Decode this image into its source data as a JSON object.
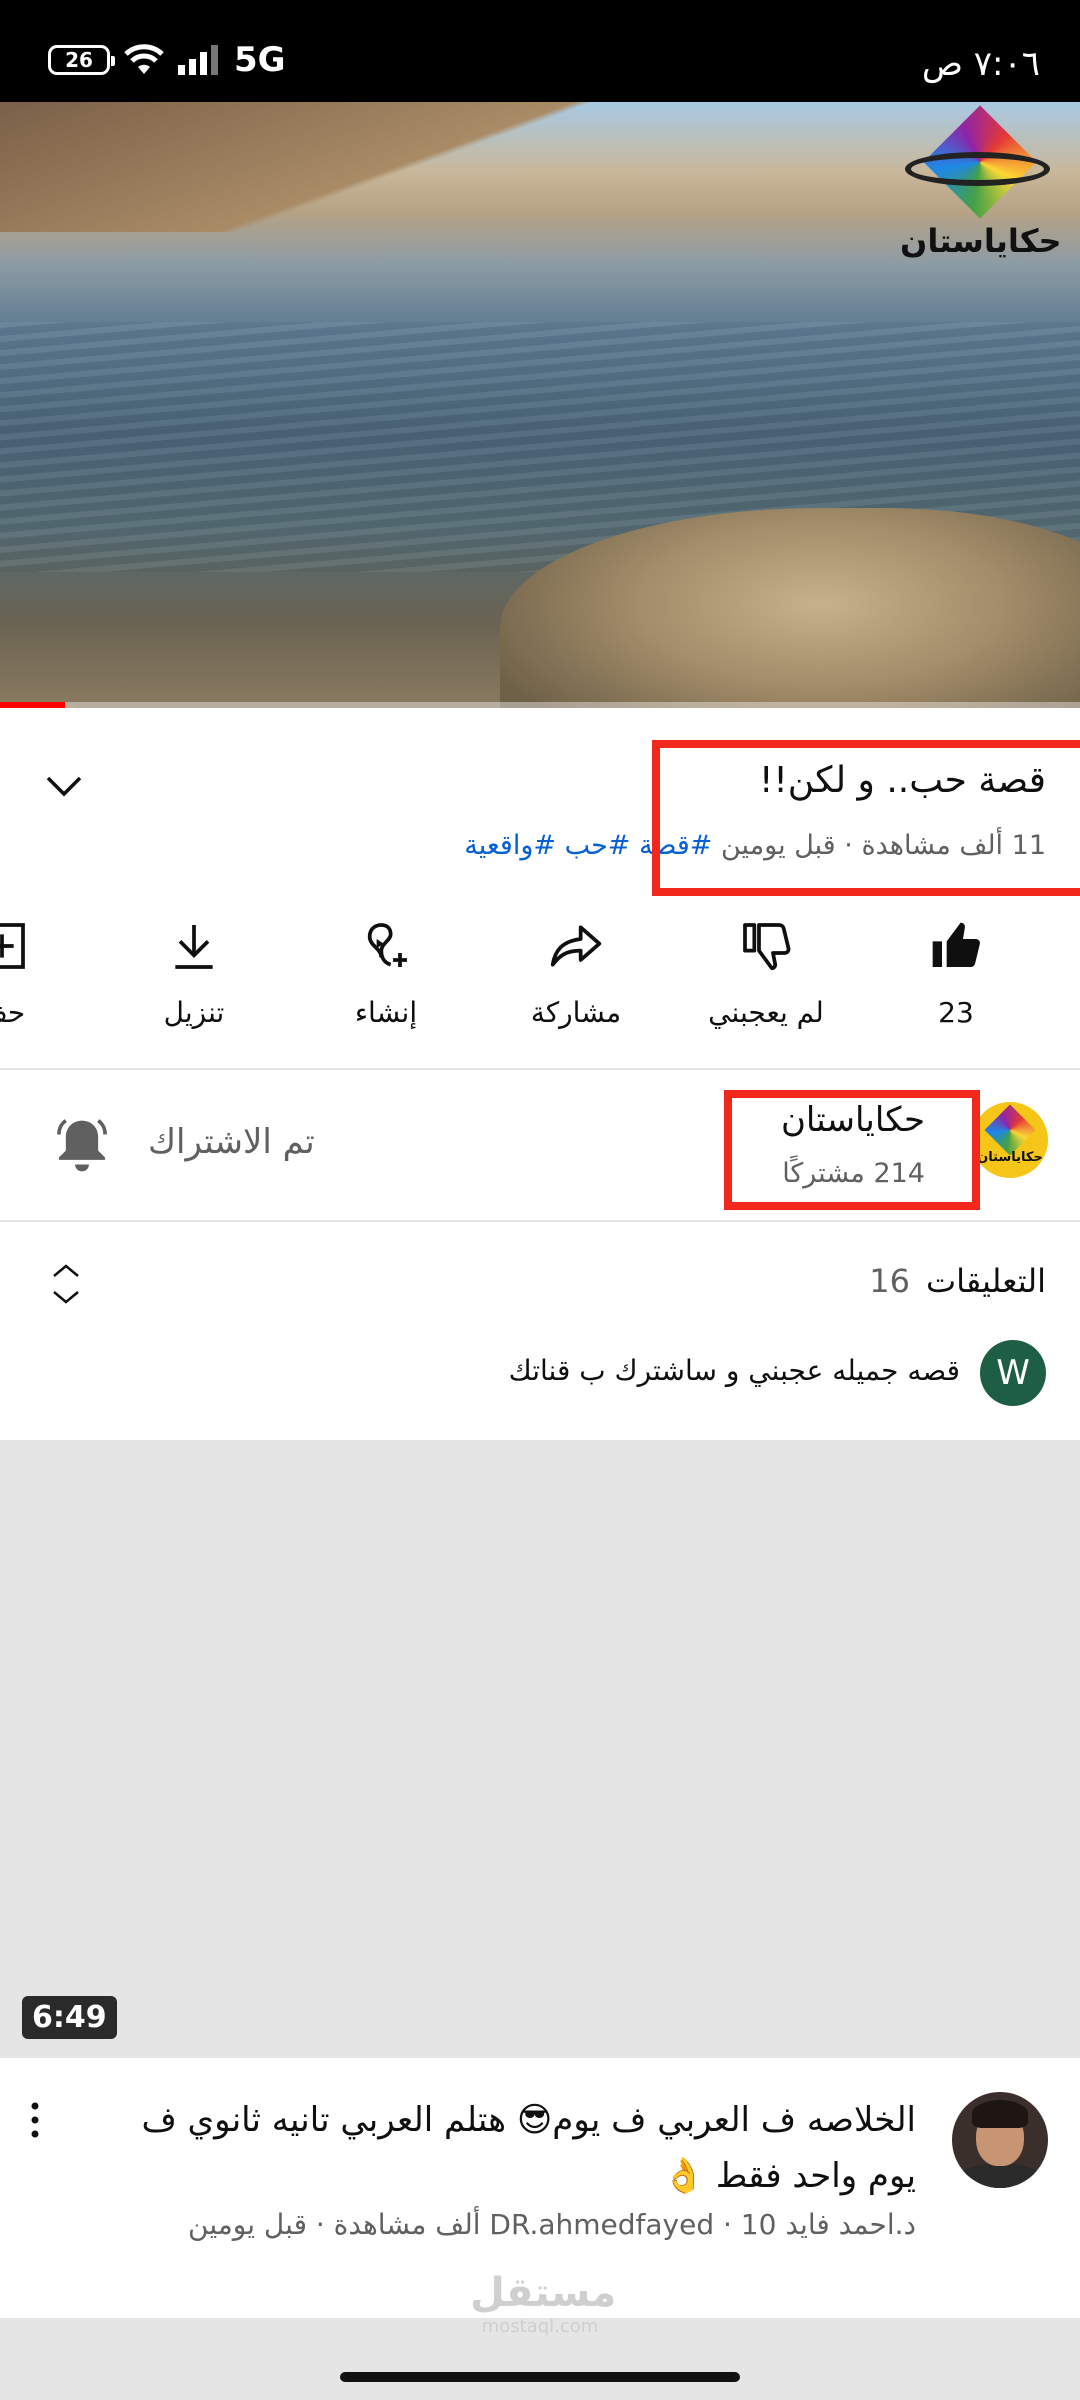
{
  "status_bar": {
    "battery_level": "26",
    "network": "5G",
    "time": "٧:٠٦ ص"
  },
  "video": {
    "logo_text": "حكاياستان",
    "watched_fraction": 0.06,
    "title": "قصة حب.. و لكن!!",
    "meta": "11 ألف مشاهدة · قبل يومين",
    "hashtags": "#قصة #حب #واقعية"
  },
  "actions": [
    {
      "icon": "thumbs-up-icon",
      "label": "23"
    },
    {
      "icon": "thumbs-down-icon",
      "label": "لم يعجبني"
    },
    {
      "icon": "share-icon",
      "label": "مشاركة"
    },
    {
      "icon": "remix-icon",
      "label": "إنشاء"
    },
    {
      "icon": "download-icon",
      "label": "تنزيل"
    },
    {
      "icon": "save-to-playlist-icon",
      "label": "حف"
    }
  ],
  "channel": {
    "name": "حكاياستان",
    "subscribers": "214 مشتركًا",
    "avatar_text": "حكاياستان",
    "subscribe_state": "تم الاشتراك"
  },
  "comments": {
    "title": "التعليقات",
    "count": "16",
    "first_comment_avatar": "W",
    "first_comment": "قصه جميله عجبني و ساشترك ب قناتك"
  },
  "recommended": {
    "duration": "6:49",
    "title": "الخلاصه ف العربي ف يوم😎 هتلم العربي تانيه ثانوي ف يوم واحد فقط 👌",
    "meta": "د.احمد فايد DR.ahmedfayed · 10 ألف مشاهدة · قبل يومين"
  },
  "watermark": {
    "brand": "مستقل",
    "domain": "mostaql.com"
  },
  "colors": {
    "highlight_box": "#f2281c",
    "link": "#065fd4",
    "secondary_text": "#606060",
    "placeholder_gray": "#e5e5e5"
  }
}
